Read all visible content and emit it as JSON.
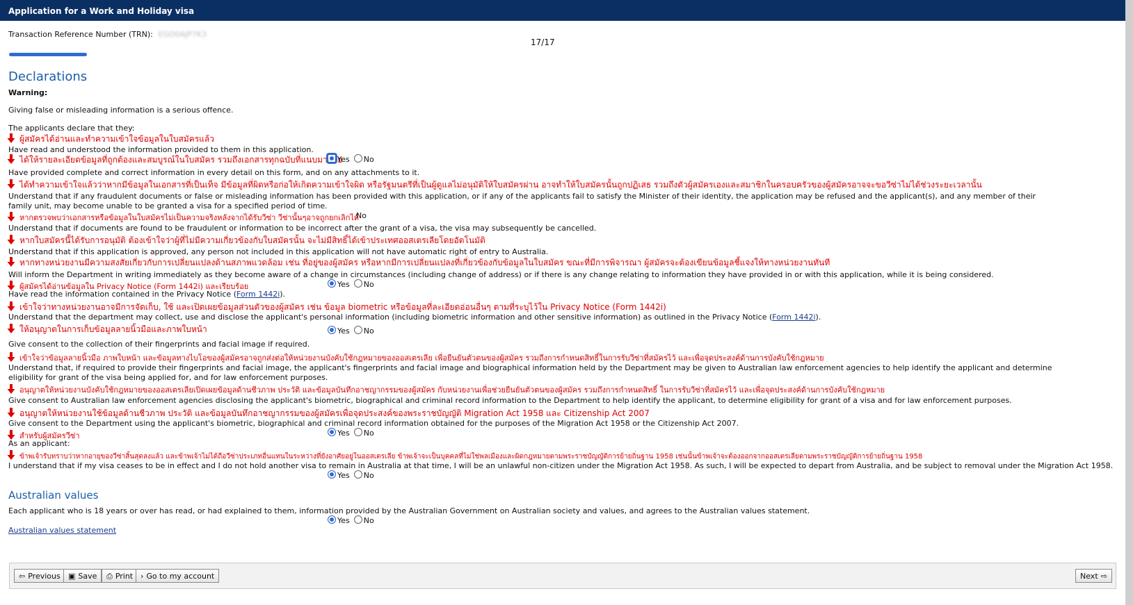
{
  "window": {
    "title": "Application for a Work and Holiday visa"
  },
  "trn": {
    "label": "Transaction Reference Number (TRN):",
    "value": "EGO0AJP7K3"
  },
  "progress": {
    "page": "17/17",
    "fraction": 1.0
  },
  "declarations": {
    "heading": "Declarations",
    "warning_label": "Warning:",
    "warning_text": "Giving false or misleading information is a serious offence.",
    "intro": "The applicants declare that they:",
    "items": [
      {
        "th": "ผู้สมัครได้อ่านและทำความเข้าใจข้อมูลในใบสมัครแล้ว",
        "en": "Have read and understood the information provided to them in this application."
      },
      {
        "th": "ได้ให้รายละเอียดข้อมูลที่ถูกต้องและสมบูรณ์ในใบสมัคร รวมถึงเอกสารทุกฉบับที่แนบมาด้วย",
        "en": "Have provided complete and correct information in every detail on this form, and on any attachments to it."
      },
      {
        "th": "ได้ทำความเข้าใจแล้วว่าหากมีข้อมูลในเอกสารที่เป็นเท็จ มีข้อมูลที่ผิดหรือก่อให้เกิดความเข้าใจผิด หรือรัฐมนตรีที่เป็นผู้ดูแลไม่อนุมัติให้ใบสมัครผ่าน อาจทำให้ใบสมัครนั้นถูกปฏิเสธ รวมถึงตัวผู้สมัครเองและสมาชิกในครอบครัวของผู้สมัครอาจจะขอวีซ่าไม่ได้ช่วงระยะเวลานั้น",
        "en": "Understand that if any fraudulent documents or false or misleading information has been provided with this application, or if any of the applicants fail to satisfy the Minister of their identity, the application may be refused and the applicant(s), and any member of their family unit, may become unable to be granted a visa for a specified period of time."
      },
      {
        "th": "หากตรวจพบว่าเอกสารหรือข้อมูลในใบสมัครไม่เป็นความจริงหลังจากได้รับวีซ่า วีซ่านั้นๆอาจถูกยกเลิกได้",
        "en": "Understand that if documents are found to be fraudulent or information to be incorrect after the grant of a visa, the visa may subsequently be cancelled."
      },
      {
        "th": "หากใบสมัครนี้ได้รับการอนุมัติ ต้องเข้าใจว่าผู้ที่ไม่มีความเกี่ยวข้องกับใบสมัครนั้น จะไม่มีสิทธิ์ได้เข้าประเทศออสเตรเลียโดยอัตโนมัติ",
        "en": "Understand that if this application is approved, any person not included in this application will not have automatic right of entry to Australia."
      },
      {
        "th": "หากทางหน่วยงานมีความสงสัยเกี่ยวกับการเปลี่ยนแปลงด้านสภาพแวดล้อม เช่น ที่อยู่ของผู้สมัคร หรือหากมีการเปลี่ยนแปลงที่เกี่ยวข้องกับข้อมูลในใบสมัคร ขณะที่มีการพิจารณา ผู้สมัครจะต้องเขียนข้อมูลชี้แจงให้ทางหน่วยงานทันที",
        "en": "Will inform the Department in writing immediately as they become aware of a change in circumstances (including change of address) or if there is any change relating to information they have provided in or with this application, while it is being considered."
      },
      {
        "th": "ผู้สมัครได้อ่านข้อมูลใน Privacy Notice (Form 1442i) และเรียบร้อย",
        "en_prefix": "Have read the information contained in the Privacy Notice (",
        "en_link": "Form 1442i",
        "en_suffix": ")."
      },
      {
        "th": "เข้าใจว่าทางหน่วยงานอาจมีการจัดเก็บ, ใช้ และเปิดเผยข้อมูลส่วนตัวของผู้สมัคร เช่น ข้อมูล biometric หรือข้อมูลที่ละเอียดอ่อนอื่นๆ ตามที่ระบุไว้ใน Privacy Notice (Form 1442i)",
        "en_prefix": "Understand that the department may collect, use and disclose the applicant's personal information (including biometric information and other sensitive information) as outlined in the Privacy Notice (",
        "en_link": "Form 1442i",
        "en_suffix": ")."
      },
      {
        "th": "ให้อนุญาตในการเก็บข้อมูลลายนิ้วมือและภาพใบหน้า",
        "en": "Give consent to the collection of their fingerprints and facial image if required."
      },
      {
        "th": "เข้าใจว่าข้อมูลลายนิ้วมือ ภาพใบหน้า และข้อมูลทางไบโอของผู้สมัครอาจถูกส่งต่อให้หน่วยงานบังคับใช้กฎหมายของออสเตรเลีย เพื่อยืนยันตัวตนของผู้สมัคร รวมถึงการกำหนดสิทธิ์ในการรับวีซ่าที่สมัครไว้ และเพื่อจุดประสงค์ด้านการบังคับใช้กฎหมาย",
        "en": "Understand that, if required to provide their fingerprints and facial image, the applicant's fingerprints and facial image and biographical information held by the Department may be given to Australian law enforcement agencies to help identify the applicant and determine eligibility for grant of the visa being applied for, and for law enforcement purposes."
      },
      {
        "th": "อนุญาตให้หน่วยงานบังคับใช้กฎหมายของออสเตรเลียเปิดเผยข้อมูลด้านชีวภาพ ประวัติ และข้อมูลบันทึกอาชญากรรมของผู้สมัคร กับหน่วยงานเพื่อช่วยยืนยันตัวตนของผู้สมัคร รวมถึงการกำหนดสิทธิ์ ในการรับวีซ่าที่สมัครไว้ และเพื่อจุดประสงค์ด้านการบังคับใช้กฎหมาย",
        "en": "Give consent to Australian law enforcement agencies disclosing the applicant's biometric, biographical and criminal record information to the Department to help identify the applicant, to determine eligibility for grant of a visa and for law enforcement purposes."
      },
      {
        "th": "อนุญาตให้หน่วยงานใช้ข้อมูลด้านชีวภาพ ประวัติ และข้อมูลบันทึกอาชญากรรมของผู้สมัครเพื่อจุดประสงค์ของพระราชบัญญัติ Migration Act 1958 และ Citizenship Act 2007",
        "en": "Give consent to the Department using the applicant's biometric, biographical and criminal record information obtained for the purposes of the Migration Act 1958 or the Citizenship Act 2007."
      },
      {
        "th": "สำหรับผู้สมัครวีซ่า",
        "en": "As an applicant:"
      },
      {
        "th": "ข้าพเจ้ารับทราบว่าหากอายุของวีซ่าสิ้นสุดลงแล้ว และข้าพเจ้าไม่ได้ถือวีซ่าประเภทอื่นแทนในระหว่างที่ยังอาศัยอยู่ในออสเตรเลีย ข้าพเจ้าจะเป็นบุคคลที่ไม่ใช่พลเมืองและผิดกฎหมายตามพระราชบัญญัติการย้ายถิ่นฐาน 1958 เช่นนั้นข้าพเจ้าจะต้องออกจากออสเตรเลียตามพระราชบัญญัติการย้ายถิ่นฐาน 1958",
        "en": "I understand that if my visa ceases to be in effect and I do not hold another visa to remain in Australia at that time, I will be an unlawful non-citizen under the Migration Act 1958. As such, I will be expected to depart from Australia, and be subject to removal under the Migration Act 1958."
      }
    ]
  },
  "radio": {
    "yes": "Yes",
    "no": "No"
  },
  "australian_values": {
    "heading": "Australian values",
    "text": "Each applicant who is 18 years or over has read, or had explained to them, information provided by the Australian Government on Australian society and values, and agrees to the Australian values statement.",
    "link": "Australian values statement"
  },
  "toolbar": {
    "previous": "Previous",
    "save": "Save",
    "print": "Print",
    "account": "Go to my account",
    "next": "Next"
  },
  "colors": {
    "titlebar": "#0a2f63",
    "heading": "#1a5fa8",
    "annotation": "#e00000",
    "progress": "#2c6fd0"
  }
}
